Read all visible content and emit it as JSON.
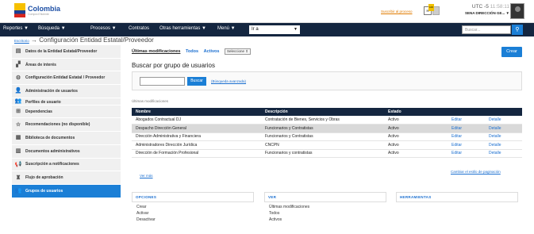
{
  "header": {
    "brand": "Colombia",
    "brand_sub": "Compra Eficiente",
    "suscribir": "Suscribir al proceso",
    "badge": "100",
    "time": "UTC -5",
    "clock": "11:58:11",
    "direction": "SENA DIRECCIÓN GE..."
  },
  "nav": {
    "items": [
      "Reportes",
      "Búsqueda",
      "Procesos",
      "Contratos",
      "Otras herramientas",
      "Menú"
    ],
    "go_label": "Ir a",
    "search_placeholder": "Buscar..."
  },
  "breadcrumb": {
    "home": "Escritorio",
    "arrow": "→",
    "title": "Configuración Entidad Estatal/Proveedor"
  },
  "sidebar": {
    "items": [
      {
        "label": "Datos de la Entidad Estatal/Proveedor",
        "icon": "building-card-icon"
      },
      {
        "label": "Áreas de interés",
        "icon": "blocks-icon"
      },
      {
        "label": "Configuración Entidad Estatal / Proveedor",
        "icon": "gears-icon"
      },
      {
        "label": "Administración de usuarios",
        "icon": "user-icon"
      },
      {
        "label": "Perfiles de usuario",
        "icon": "users-icon"
      },
      {
        "label": "Dependencias",
        "icon": "org-chart-icon"
      },
      {
        "label": "Recomendaciones (no disponible)",
        "icon": "star-icon"
      },
      {
        "label": "Biblioteca de documentos",
        "icon": "documents-icon"
      },
      {
        "label": "Documentos administrativos",
        "icon": "admin-docs-icon"
      },
      {
        "label": "Suscripción a notificaciones",
        "icon": "megaphone-icon"
      },
      {
        "label": "Flujo de aprobación",
        "icon": "approval-icon"
      },
      {
        "label": "Grupos de usuarios",
        "icon": "group-icon"
      }
    ]
  },
  "main": {
    "tabs": [
      "Últimas modificaciones",
      "Todos",
      "Activos"
    ],
    "tab_select": "Seleccione ⇕",
    "create_label": "Crear",
    "heading": "Buscar por grupo de usuarios",
    "search_button": "Buscar",
    "advanced_search": "(Búsqueda avanzada)",
    "section_label": "Últimas modificaciones",
    "columns": [
      "Nombre",
      "Descripción",
      "Estado",
      "",
      ""
    ],
    "rows": [
      {
        "nombre": "Abogados Contractual DJ",
        "descripcion": "Contratación de Bienes, Servicios y Obras",
        "estado": "Activo",
        "editar": "Editar",
        "detalle": "Detalle"
      },
      {
        "nombre": "Despacho Dirección General",
        "descripcion": "Funcionarios y Contratistas",
        "estado": "Activo",
        "editar": "Editar",
        "detalle": "Detalle"
      },
      {
        "nombre": "Dirección Administrativa y Financiera",
        "descripcion": "Funcionarios y Contratistas",
        "estado": "Activo",
        "editar": "Editar",
        "detalle": "Detalle"
      },
      {
        "nombre": "Administradores Dirección Jurídica",
        "descripcion": "CNCPN",
        "estado": "Activo",
        "editar": "Editar",
        "detalle": "Detalle"
      },
      {
        "nombre": "Dirección de Formación Profesional",
        "descripcion": "Funcionarios y contratistas",
        "estado": "Activo",
        "editar": "Editar",
        "detalle": "Detalle"
      }
    ],
    "see_more": "Ver más",
    "pagination_link": "Cambiar el estilo de paginación"
  },
  "panels": {
    "opciones": {
      "title": "OPCIONES",
      "items": [
        "Crear",
        "Activar",
        "Desactivar"
      ]
    },
    "ver": {
      "title": "VER",
      "items": [
        "Últimas modificaciones",
        "Todos",
        "Activos"
      ]
    },
    "herramientas": {
      "title": "HERRAMIENTAS",
      "items": []
    }
  }
}
